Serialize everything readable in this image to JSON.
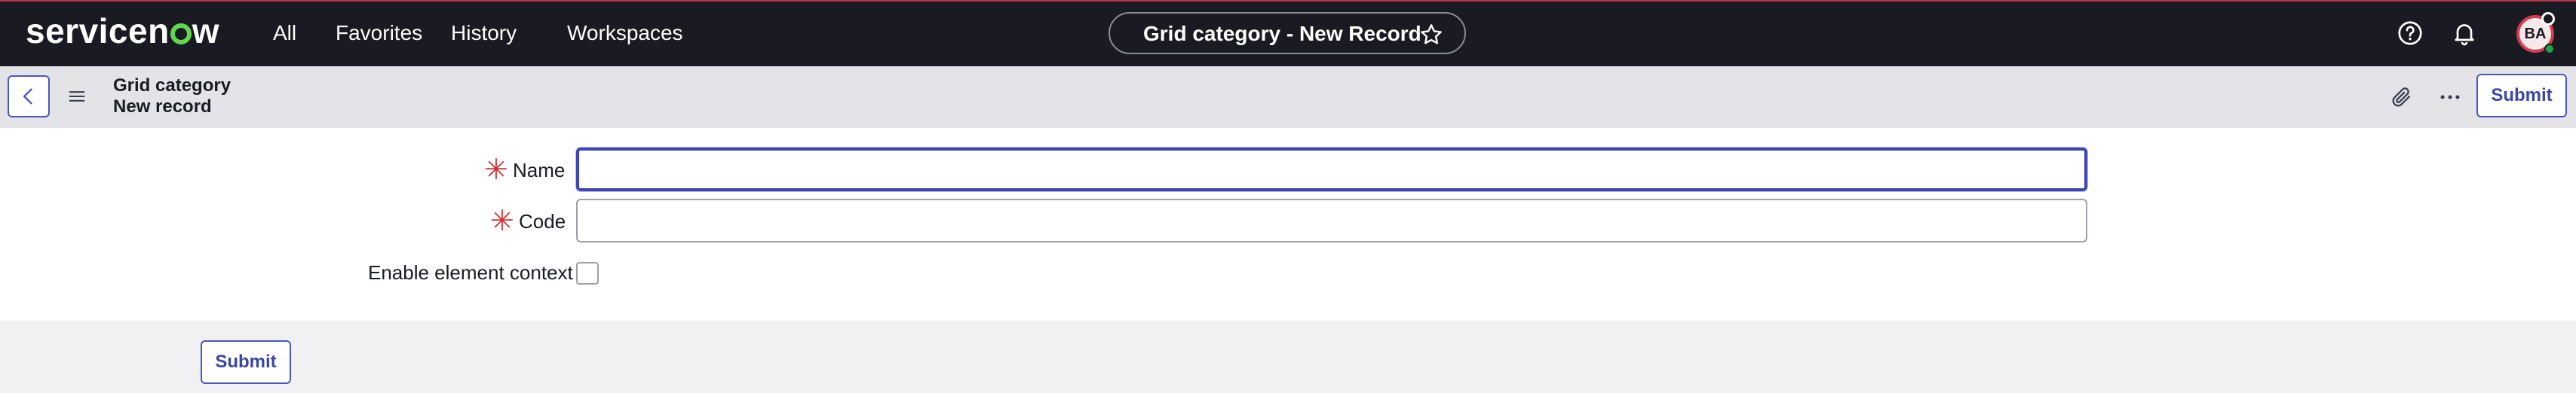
{
  "app": {
    "logo_text_a": "servicen",
    "logo_text_b": "w"
  },
  "nav": {
    "items": [
      "All",
      "Favorites",
      "History",
      "Workspaces"
    ]
  },
  "title_pill": {
    "text": "Grid category - New Record"
  },
  "user": {
    "initials": "BA"
  },
  "header": {
    "title": "Grid category",
    "subtitle": "New record",
    "submit_label": "Submit"
  },
  "form": {
    "fields": [
      {
        "label": "Name",
        "required": true,
        "value": ""
      },
      {
        "label": "Code",
        "required": true,
        "value": ""
      },
      {
        "label": "Enable element context",
        "required": false,
        "checked": false
      }
    ],
    "required_marker": "✳"
  },
  "footer": {
    "submit_label": "Submit"
  },
  "colors": {
    "nav_bg": "#1a1b22",
    "accent": "#3d47b4",
    "required": "#d13434",
    "logo_o": "#62d84e"
  }
}
